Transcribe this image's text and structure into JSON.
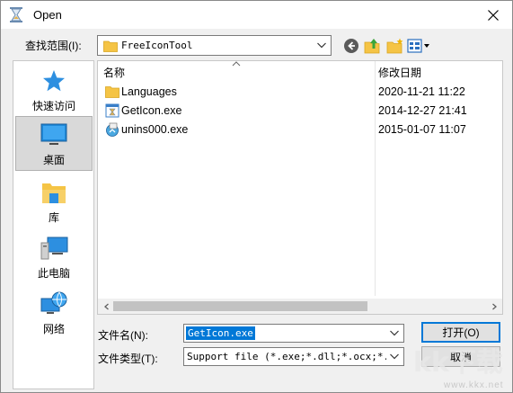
{
  "window": {
    "title": "Open",
    "close_symbol": "✕"
  },
  "lookin": {
    "label": "查找范围(I):",
    "value": "FreeIconTool"
  },
  "toolbar": {
    "back_icon": "back-arrow-icon",
    "up_icon": "up-folder-icon",
    "new_folder_icon": "new-folder-icon",
    "view_menu_icon": "view-menu-icon"
  },
  "places": [
    {
      "label": "快速访问",
      "icon": "star-icon"
    },
    {
      "label": "桌面",
      "icon": "desktop-icon",
      "selected": true
    },
    {
      "label": "库",
      "icon": "library-icon"
    },
    {
      "label": "此电脑",
      "icon": "computer-icon"
    },
    {
      "label": "网络",
      "icon": "network-icon"
    }
  ],
  "columns": {
    "name": "名称",
    "date": "修改日期"
  },
  "files": [
    {
      "name": "Languages",
      "date": "2020-11-21 11:22",
      "icon": "folder-icon"
    },
    {
      "name": "GetIcon.exe",
      "date": "2014-12-27 21:41",
      "icon": "exe-icon"
    },
    {
      "name": "unins000.exe",
      "date": "2015-01-07 11:07",
      "icon": "installer-icon"
    }
  ],
  "filename": {
    "label": "文件名(N):",
    "value": "GetIcon.exe"
  },
  "filetype": {
    "label": "文件类型(T):",
    "value": "Support file (*.exe;*.dll;*.ocx;*.cpl"
  },
  "buttons": {
    "open": "打开(O)",
    "cancel": "取消"
  },
  "watermark": {
    "text": "kk下载",
    "site": "www.kkx.net"
  },
  "colors": {
    "accent": "#0078d7",
    "selection": "#0078d7",
    "folder": "#f5c445"
  }
}
